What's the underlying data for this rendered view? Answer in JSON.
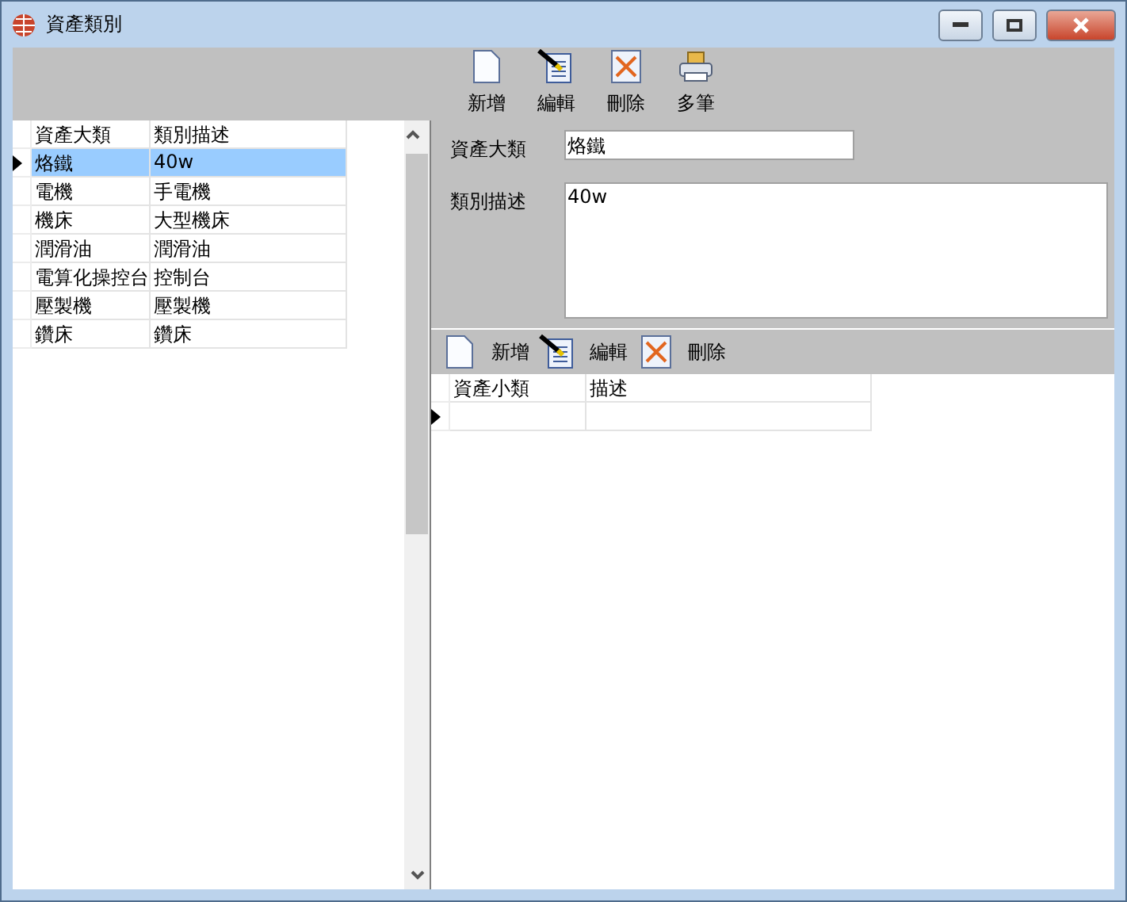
{
  "window": {
    "title": "資產類別"
  },
  "toolbar": [
    {
      "kind": "new",
      "label": "新增"
    },
    {
      "kind": "edit",
      "label": "編輯"
    },
    {
      "kind": "delete",
      "label": "刪除"
    },
    {
      "kind": "multi",
      "label": "多筆"
    }
  ],
  "category_grid": {
    "columns": [
      "資產大類",
      "類別描述"
    ],
    "rows": [
      {
        "cells": [
          "烙鐵",
          "40w"
        ],
        "selected": true
      },
      {
        "cells": [
          "電機",
          "手電機"
        ],
        "selected": false
      },
      {
        "cells": [
          "機床",
          "大型機床"
        ],
        "selected": false
      },
      {
        "cells": [
          "潤滑油",
          "潤滑油"
        ],
        "selected": false
      },
      {
        "cells": [
          "電算化操控台",
          "控制台"
        ],
        "selected": false
      },
      {
        "cells": [
          "壓製機",
          "壓製機"
        ],
        "selected": false
      },
      {
        "cells": [
          "鑽床",
          "鑽床"
        ],
        "selected": false
      }
    ]
  },
  "form": {
    "fields": [
      {
        "label": "資產大類",
        "value": "烙鐵",
        "kind": "line"
      },
      {
        "label": "類別描述",
        "value": "40w",
        "kind": "area"
      }
    ]
  },
  "detail_toolbar": [
    {
      "kind": "new",
      "label": "新增"
    },
    {
      "kind": "edit",
      "label": "編輯"
    },
    {
      "kind": "delete",
      "label": "刪除"
    }
  ],
  "detail_grid": {
    "columns": [
      "資產小類",
      "描述"
    ],
    "rows": [
      {
        "current": true
      }
    ]
  }
}
